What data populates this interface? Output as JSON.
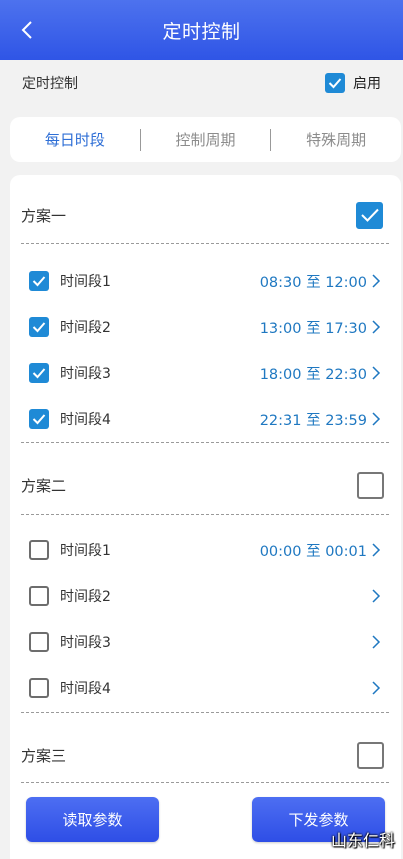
{
  "header": {
    "title": "定时控制"
  },
  "enable": {
    "label": "定时控制",
    "checkbox_label": "启用",
    "checked": true
  },
  "tabs": [
    {
      "label": "每日时段",
      "active": true
    },
    {
      "label": "控制周期",
      "active": false
    },
    {
      "label": "特殊周期",
      "active": false
    }
  ],
  "plans": [
    {
      "title": "方案一",
      "checked": true,
      "segments": [
        {
          "label": "时间段1",
          "checked": true,
          "time": "08:30 至 12:00"
        },
        {
          "label": "时间段2",
          "checked": true,
          "time": "13:00 至 17:30"
        },
        {
          "label": "时间段3",
          "checked": true,
          "time": "18:00 至 22:30"
        },
        {
          "label": "时间段4",
          "checked": true,
          "time": "22:31 至 23:59"
        }
      ]
    },
    {
      "title": "方案二",
      "checked": false,
      "segments": [
        {
          "label": "时间段1",
          "checked": false,
          "time": "00:00 至 00:01"
        },
        {
          "label": "时间段2",
          "checked": false,
          "time": ""
        },
        {
          "label": "时间段3",
          "checked": false,
          "time": ""
        },
        {
          "label": "时间段4",
          "checked": false,
          "time": ""
        }
      ]
    },
    {
      "title": "方案三",
      "checked": false
    }
  ],
  "buttons": {
    "read": "读取参数",
    "send": "下发参数"
  },
  "watermark": "山东仁科",
  "colors": {
    "accent": "#2f55e6",
    "checkbox": "#1f8ad6",
    "time_text": "#1f78c1",
    "tab_active": "#2f6fd6"
  }
}
